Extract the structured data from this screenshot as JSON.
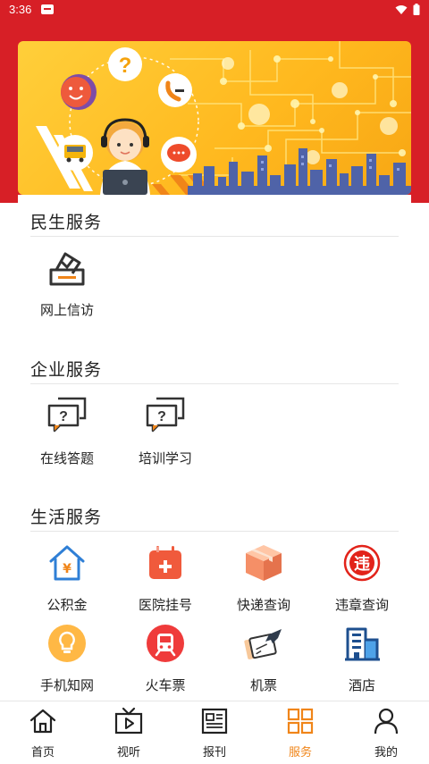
{
  "status_bar": {
    "time": "3:36"
  },
  "sections": [
    {
      "title": "民生服务",
      "items": [
        {
          "label": "网上信访",
          "icon": "ballot-box-icon"
        }
      ]
    },
    {
      "title": "企业服务",
      "items": [
        {
          "label": "在线答题",
          "icon": "question-chat-icon"
        },
        {
          "label": "培训学习",
          "icon": "question-chat-icon"
        }
      ]
    },
    {
      "title": "生活服务",
      "items": [
        {
          "label": "公积金",
          "icon": "housing-fund-icon"
        },
        {
          "label": "医院挂号",
          "icon": "hospital-calendar-icon"
        },
        {
          "label": "快递查询",
          "icon": "parcel-box-icon"
        },
        {
          "label": "违章查询",
          "icon": "traffic-violation-icon"
        },
        {
          "label": "手机知网",
          "icon": "lightbulb-icon"
        },
        {
          "label": "火车票",
          "icon": "train-icon"
        },
        {
          "label": "机票",
          "icon": "flight-ticket-icon"
        },
        {
          "label": "酒店",
          "icon": "hotel-building-icon"
        }
      ]
    }
  ],
  "tabbar": {
    "active": "服务",
    "accent_color": "#f08519",
    "items": [
      {
        "label": "首页",
        "icon": "home-icon"
      },
      {
        "label": "视听",
        "icon": "tv-play-icon"
      },
      {
        "label": "报刊",
        "icon": "newspaper-icon"
      },
      {
        "label": "服务",
        "icon": "grid-icon"
      },
      {
        "label": "我的",
        "icon": "user-icon"
      }
    ]
  },
  "colors": {
    "header_red": "#d71f26",
    "banner_yellow": "#ffc22a"
  }
}
